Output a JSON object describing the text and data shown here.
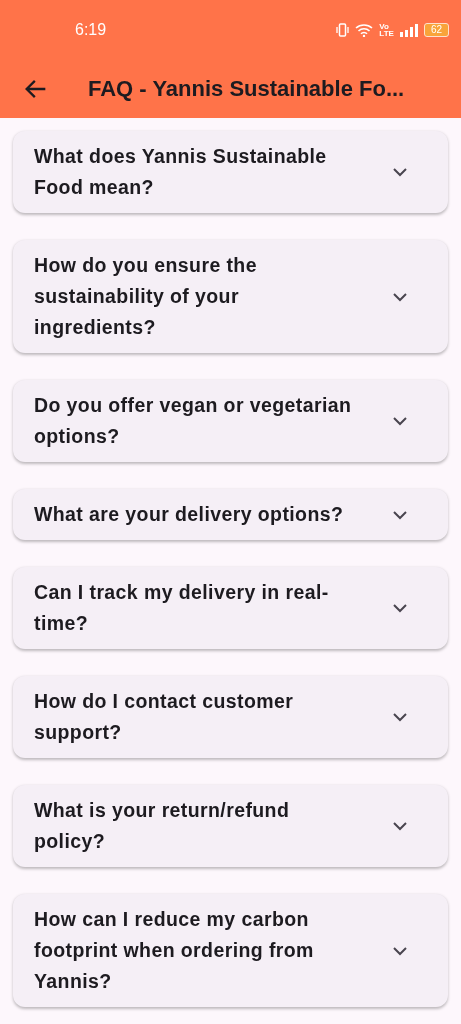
{
  "status_bar": {
    "time": "6:19",
    "volte": [
      "Vo",
      "LTE"
    ],
    "battery": "62"
  },
  "app_bar": {
    "title": "FAQ - Yannis Sustainable Fo..."
  },
  "faqs": [
    {
      "question": "What does Yannis Sustainable Food mean?",
      "expanded": false
    },
    {
      "question": "How do you ensure the sustainability of your ingredients?",
      "expanded": false
    },
    {
      "question": "Do you offer vegan or vegetarian options?",
      "expanded": false
    },
    {
      "question": "What are your delivery options?",
      "expanded": false
    },
    {
      "question": "Can I track my delivery in real-time?",
      "expanded": false
    },
    {
      "question": "How do I contact customer support?",
      "expanded": false
    },
    {
      "question": "What is your return/refund policy?",
      "expanded": false
    },
    {
      "question": "How can I reduce my carbon footprint when ordering from Yannis?",
      "expanded": false
    }
  ]
}
